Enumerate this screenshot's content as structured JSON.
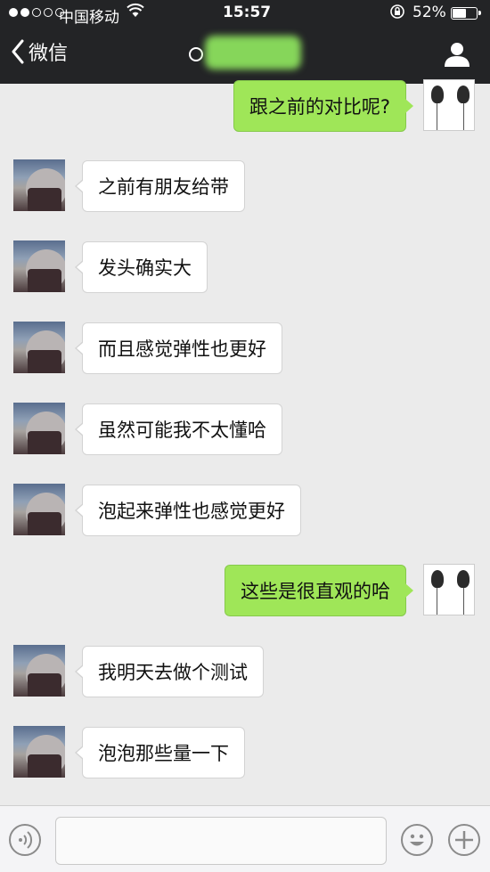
{
  "status_bar": {
    "carrier": "中国移动",
    "time": "15:57",
    "battery": "52%",
    "battery_level": 0.52
  },
  "nav": {
    "back_label": "微信"
  },
  "messages": [
    {
      "side": "out",
      "text": "跟之前的对比呢?"
    },
    {
      "side": "in",
      "text": "之前有朋友给带"
    },
    {
      "side": "in",
      "text": "发头确实大"
    },
    {
      "side": "in",
      "text": "而且感觉弹性也更好"
    },
    {
      "side": "in",
      "text": "虽然可能我不太懂哈"
    },
    {
      "side": "in",
      "text": "泡起来弹性也感觉更好"
    },
    {
      "side": "out",
      "text": "这些是很直观的哈"
    },
    {
      "side": "in",
      "text": "我明天去做个测试"
    },
    {
      "side": "in",
      "text": "泡泡那些量一下"
    }
  ],
  "colors": {
    "nav_bg": "#232426",
    "chat_bg": "#ebebeb",
    "outgoing_bubble": "#9fe658",
    "incoming_bubble": "#ffffff"
  }
}
